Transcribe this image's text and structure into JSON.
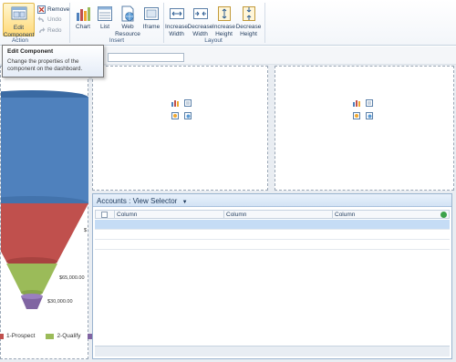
{
  "ribbon": {
    "action": {
      "group_label": "Action",
      "edit_component_line1": "Edit",
      "edit_component_line2": "Component",
      "remove_label": "Remove",
      "undo_label": "Undo",
      "redo_label": "Redo"
    },
    "insert": {
      "group_label": "Insert",
      "chart_label": "Chart",
      "list_label": "List",
      "web_resource_line1": "Web",
      "web_resource_line2": "Resource",
      "iframe_label": "Iframe"
    },
    "layout": {
      "group_label": "Layout",
      "increase_width_line1": "Increase",
      "increase_width_line2": "Width",
      "decrease_width_line1": "Decrease",
      "decrease_width_line2": "Width",
      "increase_height_line1": "Increase",
      "increase_height_line2": "Height",
      "decrease_height_line1": "Decrease",
      "decrease_height_line2": "Height"
    }
  },
  "tooltip": {
    "title": "Edit Component",
    "body": "Change the properties of the component on the dashboard."
  },
  "grid": {
    "title": "Accounts : View Selector",
    "columns": [
      "Column",
      "Column",
      "Column"
    ]
  },
  "funnel": {
    "labels": [
      "$",
      "$65,000.00",
      "$30,000.00"
    ],
    "legend": [
      "1-Prospect",
      "2-Qualify"
    ],
    "colors": {
      "top": "#4f81bd",
      "prospect": "#c0504d",
      "qualify": "#9bbb59",
      "develop": "#8064a2"
    }
  },
  "colors": {
    "accent": "#1e395b",
    "selected_row": "#c5dcf5",
    "active_button": "#ffd977"
  }
}
